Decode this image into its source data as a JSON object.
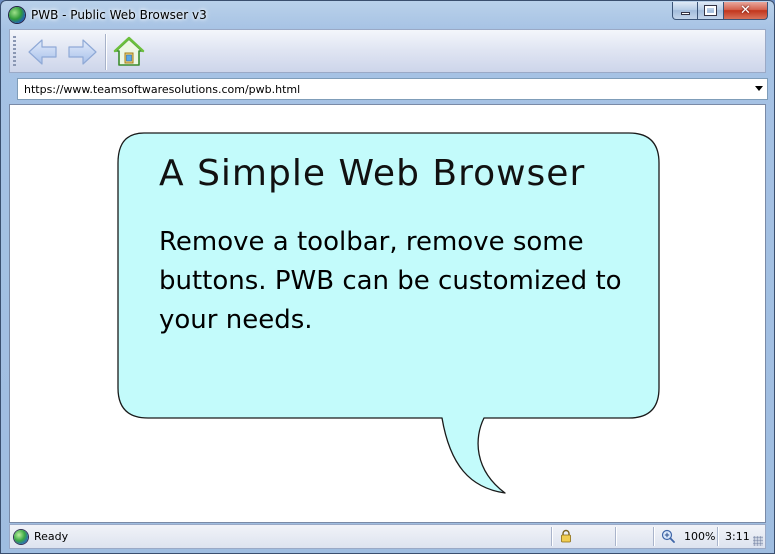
{
  "window": {
    "title": "PWB - Public Web Browser v3",
    "close_glyph": "✕"
  },
  "toolbar": {
    "buttons": [
      {
        "name": "back",
        "icon": "back-arrow-icon"
      },
      {
        "name": "forward",
        "icon": "forward-arrow-icon"
      },
      {
        "name": "home",
        "icon": "home-icon"
      }
    ]
  },
  "address": {
    "url": "https://www.teamsoftwaresolutions.com/pwb.html"
  },
  "content": {
    "bubble_title": "A Simple Web Browser",
    "bubble_text": "Remove a toolbar, remove some buttons. PWB can be customized to your needs.",
    "bubble_fill": "#c3fbfb"
  },
  "status": {
    "text": "Ready",
    "zoom": "100%",
    "time": "3:11"
  }
}
